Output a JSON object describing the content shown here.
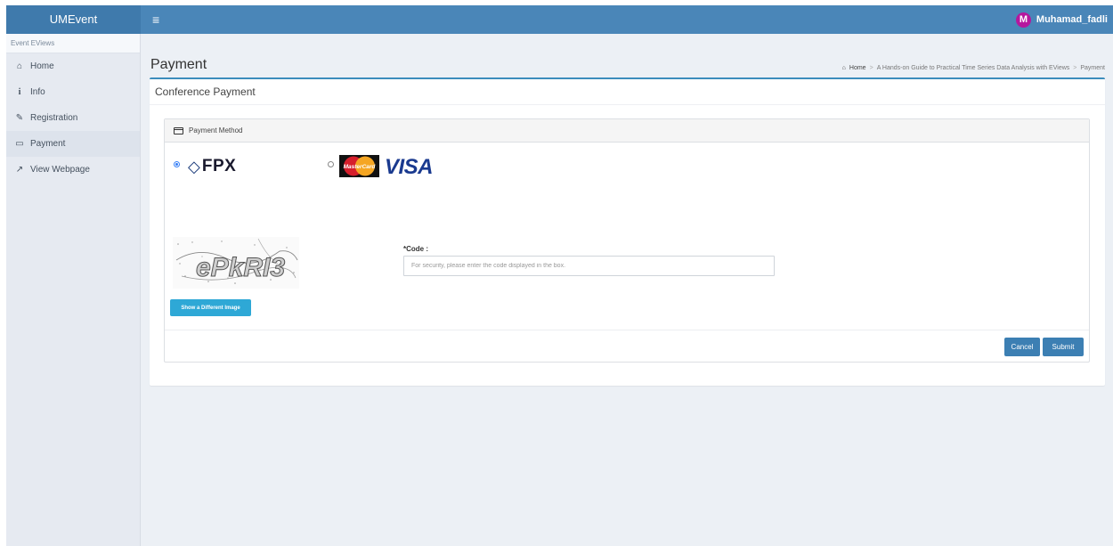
{
  "app": {
    "logo": "UMEvent",
    "menu_icon": "≡"
  },
  "user": {
    "avatar_initial": "M",
    "name": "Muhamad_fadli"
  },
  "sidebar": {
    "header": "Event EViews",
    "items": [
      {
        "label": "Home",
        "icon": "home-icon",
        "glyph": "⌂"
      },
      {
        "label": "Info",
        "icon": "info-icon",
        "glyph": "i"
      },
      {
        "label": "Registration",
        "icon": "edit-icon",
        "glyph": "✎"
      },
      {
        "label": "Payment",
        "icon": "credit-card-icon",
        "glyph": "▭"
      },
      {
        "label": "View Webpage",
        "icon": "external-link-icon",
        "glyph": "↗"
      }
    ]
  },
  "page": {
    "title": "Payment",
    "breadcrumb": {
      "home": "Home",
      "event": "A Hands-on Guide to Practical Time Series Data Analysis with EViews",
      "current": "Payment",
      "separator": ">"
    }
  },
  "box": {
    "title": "Conference Payment"
  },
  "payment": {
    "heading": "Payment Method",
    "options": [
      {
        "label": "FPX",
        "selected": true
      },
      {
        "label": "MasterCard / VISA",
        "mastercard_text": "MasterCard",
        "visa_text": "VISA",
        "selected": false
      }
    ]
  },
  "captcha": {
    "image_text": "ePkRI3",
    "refresh_label": "Show a Different Image",
    "code_label": "*Code :",
    "code_value": "",
    "code_placeholder": "For security, please enter the code displayed in the box."
  },
  "actions": {
    "cancel": "Cancel",
    "submit": "Submit"
  },
  "colors": {
    "topbar": "#4a86b8",
    "accent": "#3c8dbc",
    "button": "#3c7fb3",
    "refresh_button": "#2ea8d6",
    "avatar": "#b5179e"
  }
}
